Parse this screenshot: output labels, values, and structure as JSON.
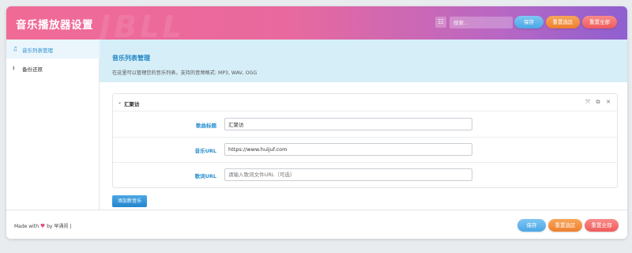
{
  "header": {
    "title": "音乐播放器设置",
    "watermark": "JBLL",
    "search_icon": "menu-toggle-icon",
    "search_placeholder": "搜索...",
    "save_label": "保存",
    "reset_selected_label": "重置选区",
    "reset_all_label": "重置全部"
  },
  "sidebar": {
    "items": [
      {
        "icon": "music-note-icon",
        "label": "音乐列表管理",
        "active": true
      },
      {
        "icon": "download-icon",
        "label": "备份还原",
        "active": false
      }
    ]
  },
  "intro": {
    "heading": "音乐列表管理",
    "description": "在这里可以管理您的音乐列表，支持的音频格式: MP3, WAV, OGG"
  },
  "card": {
    "title": "汇聚访",
    "tools": [
      "expand-icon",
      "copy-icon",
      "close-icon"
    ],
    "fields": [
      {
        "label": "歌曲标题",
        "value": "汇聚访",
        "placeholder": ""
      },
      {
        "label": "音乐URL",
        "value": "https://www.huijuf.com",
        "placeholder": ""
      },
      {
        "label": "歌词URL",
        "value": "",
        "placeholder": "请输入歌词文件URL（可选）"
      }
    ]
  },
  "add_button_label": "添加新音乐",
  "footer": {
    "made_with": "Made with",
    "by": "by 早涌闵 |",
    "save_label": "保存",
    "reset_selected_label": "重置选区",
    "reset_all_label": "重置全部"
  },
  "colors": {
    "header_gradient": [
      "#f06a96",
      "#8f5fd0"
    ],
    "accent": "#2a8fd0",
    "intro_bg": "#d6eef8",
    "save_button": "#4aa7e6",
    "reset_selected_button": "#ee7f2e",
    "reset_all_button": "#ef5a5a"
  }
}
